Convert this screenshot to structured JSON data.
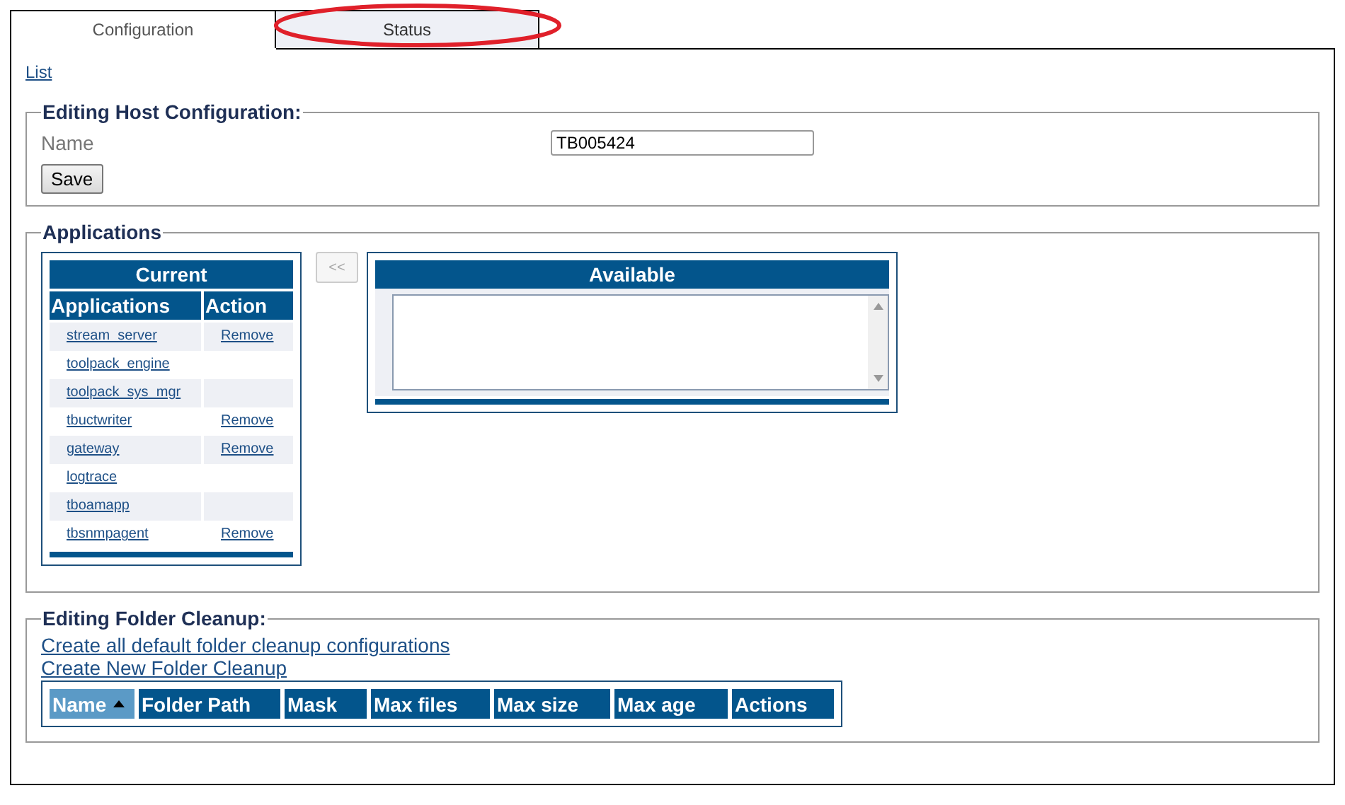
{
  "tabs": [
    {
      "label": "Configuration",
      "selected": true,
      "circled": false
    },
    {
      "label": "Status",
      "selected": false,
      "circled": true
    }
  ],
  "list_link": "List",
  "host_section": {
    "legend": "Editing Host Configuration:",
    "name_label": "Name",
    "name_value": "TB005424",
    "save_button": "Save"
  },
  "applications_section": {
    "legend": "Applications",
    "current": {
      "title": "Current",
      "columns": [
        "Applications",
        "Action"
      ],
      "rows": [
        {
          "name": "stream_server",
          "action": "Remove"
        },
        {
          "name": "toolpack_engine"
        },
        {
          "name": "toolpack_sys_mgr"
        },
        {
          "name": "tbuctwriter",
          "action": "Remove"
        },
        {
          "name": "gateway",
          "action": "Remove"
        },
        {
          "name": "logtrace"
        },
        {
          "name": "tboamapp"
        },
        {
          "name": "tbsnmpagent",
          "action": "Remove"
        }
      ]
    },
    "move_button": {
      "label": "<<",
      "disabled": true
    },
    "available": {
      "title": "Available"
    }
  },
  "cleanup_section": {
    "legend": "Editing Folder Cleanup:",
    "links": [
      "Create all default folder cleanup configurations",
      "Create New Folder Cleanup"
    ],
    "columns": [
      {
        "label": "Name",
        "sorted": true
      },
      {
        "label": "Folder Path",
        "sorted": false
      },
      {
        "label": "Mask",
        "sorted": false
      },
      {
        "label": "Max files",
        "sorted": false
      },
      {
        "label": "Max size",
        "sorted": false
      },
      {
        "label": "Max age",
        "sorted": false
      },
      {
        "label": "Actions",
        "sorted": false
      }
    ]
  }
}
